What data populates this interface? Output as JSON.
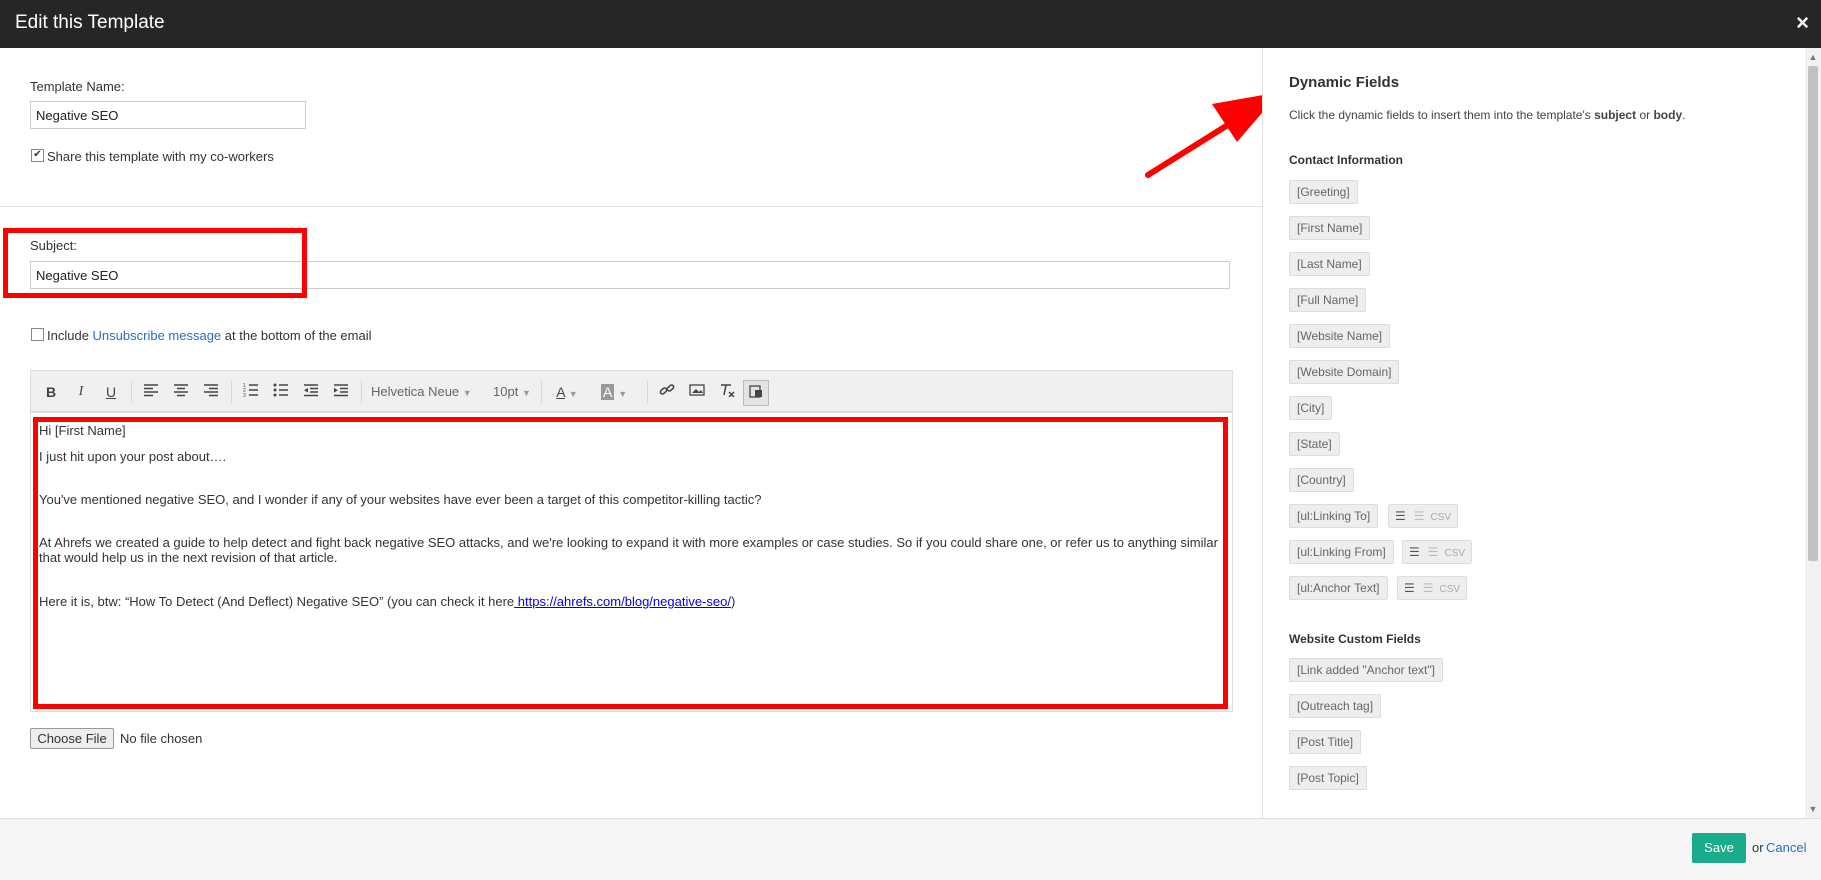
{
  "window": {
    "title": "Edit this Template",
    "close": "×"
  },
  "form": {
    "template_name_label": "Template Name:",
    "template_name_value": "Negative SEO",
    "share_checkbox_checked": true,
    "share_label": "Share this template with my co-workers",
    "subject_label": "Subject:",
    "subject_value": "Negative SEO",
    "unsub_checkbox_checked": false,
    "unsub_prefix": "Include",
    "unsub_link": "Unsubscribe message",
    "unsub_suffix": "at the bottom of the email"
  },
  "toolbar": {
    "bold": "B",
    "italic": "I",
    "underline": "U",
    "align_left_icon": "align-left-icon",
    "align_center_icon": "align-center-icon",
    "align_right_icon": "align-right-icon",
    "ordered_list_icon": "ordered-list-icon",
    "bullet_list_icon": "bullet-list-icon",
    "outdent_icon": "outdent-icon",
    "indent_icon": "indent-icon",
    "font_family": "Helvetica Neue",
    "font_size": "10pt",
    "link_icon": "link-icon",
    "image_icon": "image-icon",
    "clear_format_icon": "clear-format-icon",
    "paste_icon": "paste-icon"
  },
  "editor": {
    "line1": "Hi  [First Name]",
    "line2": "I just hit upon your post about….",
    "line3": "You've mentioned negative SEO, and I wonder if any of your websites have ever been a target of this competitor-killing tactic?",
    "line4a": "At Ahrefs we created a guide to help detect and fight back negative SEO attacks, and we're looking to expand it with more examples or case studies. So if you could share one, or refer us to anything similar",
    "line4b": "that would help us in the next revision of that article.",
    "line5_prefix": "Here it is, btw: “How To Detect (And Deflect) Negative SEO” (you can check it here",
    "line5_link": " https://ahrefs.com/blog/negative-seo/",
    "line5_suffix": ")"
  },
  "file": {
    "button": "Choose File",
    "status": "No file chosen"
  },
  "dynamic_fields": {
    "title": "Dynamic Fields",
    "desc_prefix": "Click the dynamic fields to insert them into the template's ",
    "desc_subject": "subject",
    "desc_or": " or ",
    "desc_body": "body",
    "desc_end": ".",
    "contact_section": "Contact Information",
    "contact_fields": [
      "[Greeting]",
      "[First Name]",
      "[Last Name]",
      "[Full Name]",
      "[Website Name]",
      "[Website Domain]",
      "[City]",
      "[State]",
      "[Country]"
    ],
    "list_fields": [
      "[ul:Linking To]",
      "[ul:Linking From]",
      "[ul:Anchor Text]"
    ],
    "csv_label": "CSV",
    "website_section": "Website Custom Fields",
    "website_fields": [
      "[Link added \"Anchor text\"]",
      "[Outreach tag]",
      "[Post Title]",
      "[Post Topic]"
    ]
  },
  "footer": {
    "save": "Save",
    "or": "or",
    "cancel": "Cancel"
  },
  "colors": {
    "titlebar": "#262626",
    "save": "#1aab8a",
    "annotation": "#ff0000",
    "link": "#2a6ebb"
  }
}
